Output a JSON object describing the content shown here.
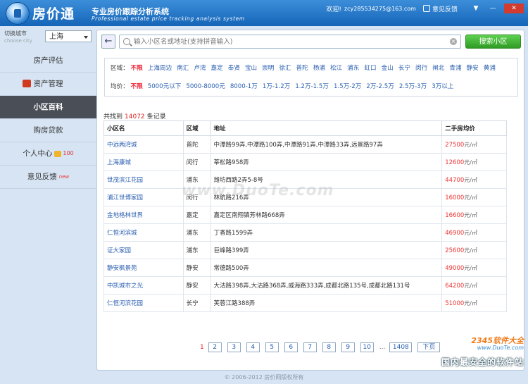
{
  "app": {
    "name": "房价通",
    "subtitle": "专业房价跟踪分析系统",
    "subtitle_en": "Professional estate price tracking analysis system"
  },
  "titlebar": {
    "welcome": "欢迎!",
    "email": "zcy285534275@163.com",
    "feedback": "意见反馈",
    "min": "▼",
    "max": "—",
    "close": "✕"
  },
  "sidebar": {
    "city_label": "切换城市",
    "city_label_en": "choose city",
    "city_value": "上海",
    "items": [
      {
        "label": "房产评估"
      },
      {
        "label": "资产管理"
      },
      {
        "label": "小区百科"
      },
      {
        "label": "购房贷款"
      },
      {
        "label": "个人中心",
        "badge": "100"
      },
      {
        "label": "意见反馈",
        "badge": "new"
      }
    ]
  },
  "search": {
    "placeholder": "输入小区名或地址(支持拼音输入)",
    "button": "搜索小区"
  },
  "filters": {
    "district_label": "区域：",
    "districts": [
      "不限",
      "上海周边",
      "南汇",
      "卢湾",
      "嘉定",
      "奉贤",
      "宝山",
      "崇明",
      "徐汇",
      "普陀",
      "杨浦",
      "松江",
      "浦东",
      "虹口",
      "金山",
      "长宁",
      "闵行",
      "闸北",
      "青浦",
      "静安",
      "黄浦"
    ],
    "price_label": "均价：",
    "prices": [
      "不限",
      "5000元以下",
      "5000-8000元",
      "8000-1万",
      "1万-1.2万",
      "1.2万-1.5万",
      "1.5万-2万",
      "2万-2.5万",
      "2.5万-3万",
      "3万以上"
    ]
  },
  "results": {
    "prefix": "共找到",
    "count": "14072",
    "suffix": "条记录",
    "columns": [
      "小区名",
      "区域",
      "地址",
      "二手房均价"
    ],
    "unit": "元/㎡",
    "rows": [
      {
        "name": "中远两湾城",
        "district": "普陀",
        "address": "中潭路99弄,中潭路100弄,中潭路91弄,中潭路33弄,远景路97弄",
        "price": "27500"
      },
      {
        "name": "上海康城",
        "district": "闵行",
        "address": "莘松路958弄",
        "price": "12600"
      },
      {
        "name": "世茂滨江花园",
        "district": "浦东",
        "address": "潍坊西路2弄5-8号",
        "price": "44700"
      },
      {
        "name": "浦江世博家园",
        "district": "闵行",
        "address": "林航路216弄",
        "price": "16000"
      },
      {
        "name": "金地格林世界",
        "district": "嘉定",
        "address": "嘉定区南翔镇芳林路668弄",
        "price": "16600"
      },
      {
        "name": "仁恒河滨城",
        "district": "浦东",
        "address": "丁香路1599弄",
        "price": "46900"
      },
      {
        "name": "证大家园",
        "district": "浦东",
        "address": "巨峰路399弄",
        "price": "25600"
      },
      {
        "name": "静安枫景苑",
        "district": "静安",
        "address": "常德路500弄",
        "price": "49000"
      },
      {
        "name": "中凯城市之光",
        "district": "静安",
        "address": "大沽路398弄,大沽路368弄,威海路333弄,成都北路135号,成都北路131号",
        "price": "64200"
      },
      {
        "name": "仁恒河滨花园",
        "district": "长宁",
        "address": "芙蓉江路388弄",
        "price": "51000"
      }
    ]
  },
  "pager": {
    "current": "1",
    "pages": [
      "2",
      "3",
      "4",
      "5",
      "6",
      "7",
      "8",
      "9",
      "10"
    ],
    "dots": "...",
    "last": "1408",
    "next": "下页"
  },
  "footer": "© 2006-2012  房价网版权所有",
  "watermarks": {
    "center": "www.DuoTe.com",
    "brand": "2345软件大全",
    "url": "www.DuoTe.com",
    "tag": "国内最安全的软件站"
  }
}
